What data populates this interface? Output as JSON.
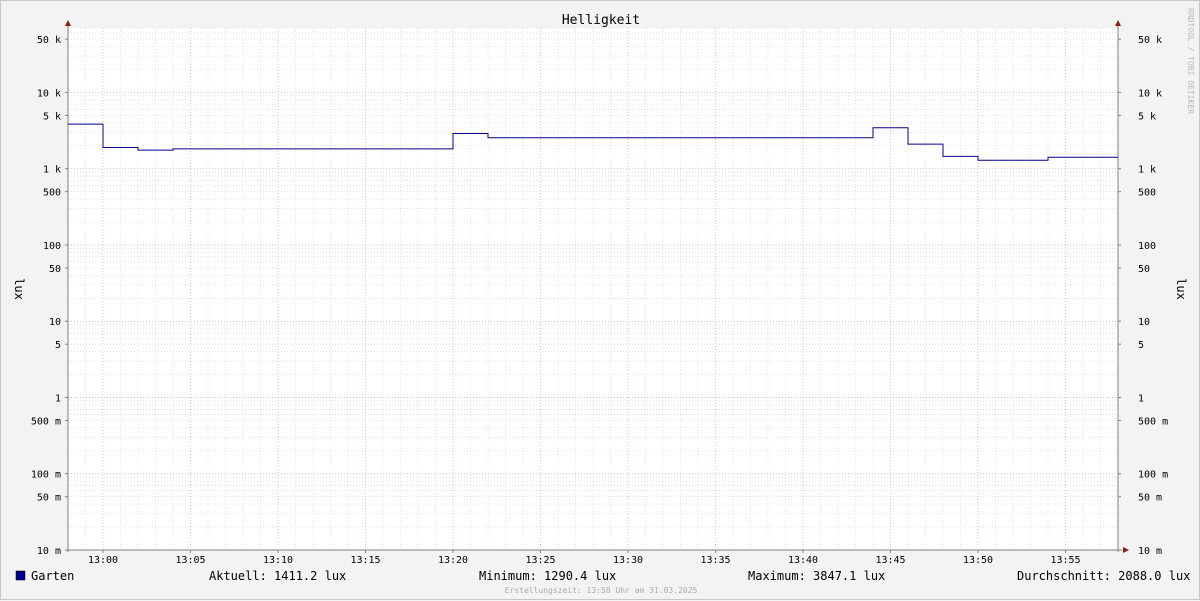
{
  "chart_data": {
    "type": "line",
    "title": "Helligkeit",
    "ylabel": "lux",
    "y_scale": "log",
    "ylim": [
      0.01,
      70000
    ],
    "xlim": [
      "12:58",
      "13:58"
    ],
    "grid": true,
    "x_ticks": [
      "13:00",
      "13:05",
      "13:10",
      "13:15",
      "13:20",
      "13:25",
      "13:30",
      "13:35",
      "13:40",
      "13:45",
      "13:50",
      "13:55"
    ],
    "y_ticks": [
      {
        "value": 50000,
        "label": "50 k"
      },
      {
        "value": 10000,
        "label": "10 k"
      },
      {
        "value": 5000,
        "label": "5 k"
      },
      {
        "value": 1000,
        "label": "1 k"
      },
      {
        "value": 500,
        "label": "500"
      },
      {
        "value": 100,
        "label": "100"
      },
      {
        "value": 50,
        "label": "50"
      },
      {
        "value": 10,
        "label": "10"
      },
      {
        "value": 5,
        "label": "5"
      },
      {
        "value": 1,
        "label": "1"
      },
      {
        "value": 0.5,
        "label": "500 m"
      },
      {
        "value": 0.1,
        "label": "100 m"
      },
      {
        "value": 0.05,
        "label": "50 m"
      },
      {
        "value": 0.01,
        "label": "10 m"
      }
    ],
    "series": [
      {
        "name": "Garten",
        "color": "#00008b",
        "points": [
          {
            "t": "12:58",
            "v": 3847.1
          },
          {
            "t": "13:00",
            "v": 3847.1
          },
          {
            "t": "13:00",
            "v": 1900
          },
          {
            "t": "13:02",
            "v": 1900
          },
          {
            "t": "13:02",
            "v": 1750
          },
          {
            "t": "13:04",
            "v": 1750
          },
          {
            "t": "13:04",
            "v": 1820
          },
          {
            "t": "13:20",
            "v": 1820
          },
          {
            "t": "13:20",
            "v": 2900
          },
          {
            "t": "13:22",
            "v": 2900
          },
          {
            "t": "13:22",
            "v": 2550
          },
          {
            "t": "13:44",
            "v": 2550
          },
          {
            "t": "13:44",
            "v": 3450
          },
          {
            "t": "13:46",
            "v": 3450
          },
          {
            "t": "13:46",
            "v": 2100
          },
          {
            "t": "13:48",
            "v": 2100
          },
          {
            "t": "13:48",
            "v": 1450
          },
          {
            "t": "13:50",
            "v": 1450
          },
          {
            "t": "13:50",
            "v": 1290.4
          },
          {
            "t": "13:54",
            "v": 1290.4
          },
          {
            "t": "13:54",
            "v": 1411.2
          },
          {
            "t": "13:58",
            "v": 1411.2
          }
        ]
      }
    ]
  },
  "legend": {
    "series_name": "Garten",
    "swatch_color": "#00008b",
    "current": "Aktuell: 1411.2 lux",
    "minimum": "Minimum: 1290.4 lux",
    "maximum": "Maximum: 3847.1 lux",
    "average": "Durchschnitt: 2088.0 lux"
  },
  "footer": "Erstellungszeit: 13:58 Uhr am 31.03.2025",
  "watermark": "RRDTOOL / TOBI OETIKER",
  "colors": {
    "background": "#f3f3f3",
    "plot_background": "#ffffff",
    "major_grid": "#e8a0a0",
    "minor_grid": "#cfcfcf",
    "axis": "#808080",
    "arrow": "#8b1a1a"
  }
}
